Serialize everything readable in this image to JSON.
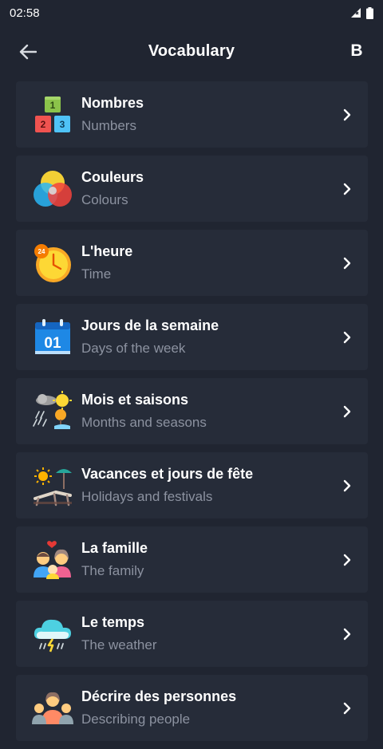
{
  "status": {
    "time": "02:58"
  },
  "appbar": {
    "title": "Vocabulary",
    "level_label": "B"
  },
  "items": [
    {
      "title": "Nombres",
      "subtitle": "Numbers",
      "icon": "number-blocks-icon"
    },
    {
      "title": "Couleurs",
      "subtitle": "Colours",
      "icon": "color-circles-icon"
    },
    {
      "title": "L'heure",
      "subtitle": "Time",
      "icon": "clock-icon"
    },
    {
      "title": "Jours de la semaine",
      "subtitle": "Days of the week",
      "icon": "calendar-icon",
      "icon_text": "01"
    },
    {
      "title": "Mois et saisons",
      "subtitle": "Months and seasons",
      "icon": "seasons-icon"
    },
    {
      "title": "Vacances et jours de fête",
      "subtitle": "Holidays and festivals",
      "icon": "beach-chair-icon"
    },
    {
      "title": "La famille",
      "subtitle": "The family",
      "icon": "family-icon"
    },
    {
      "title": "Le temps",
      "subtitle": "The weather",
      "icon": "rain-cloud-icon"
    },
    {
      "title": "Décrire des personnes",
      "subtitle": "Describing people",
      "icon": "people-icon"
    }
  ]
}
